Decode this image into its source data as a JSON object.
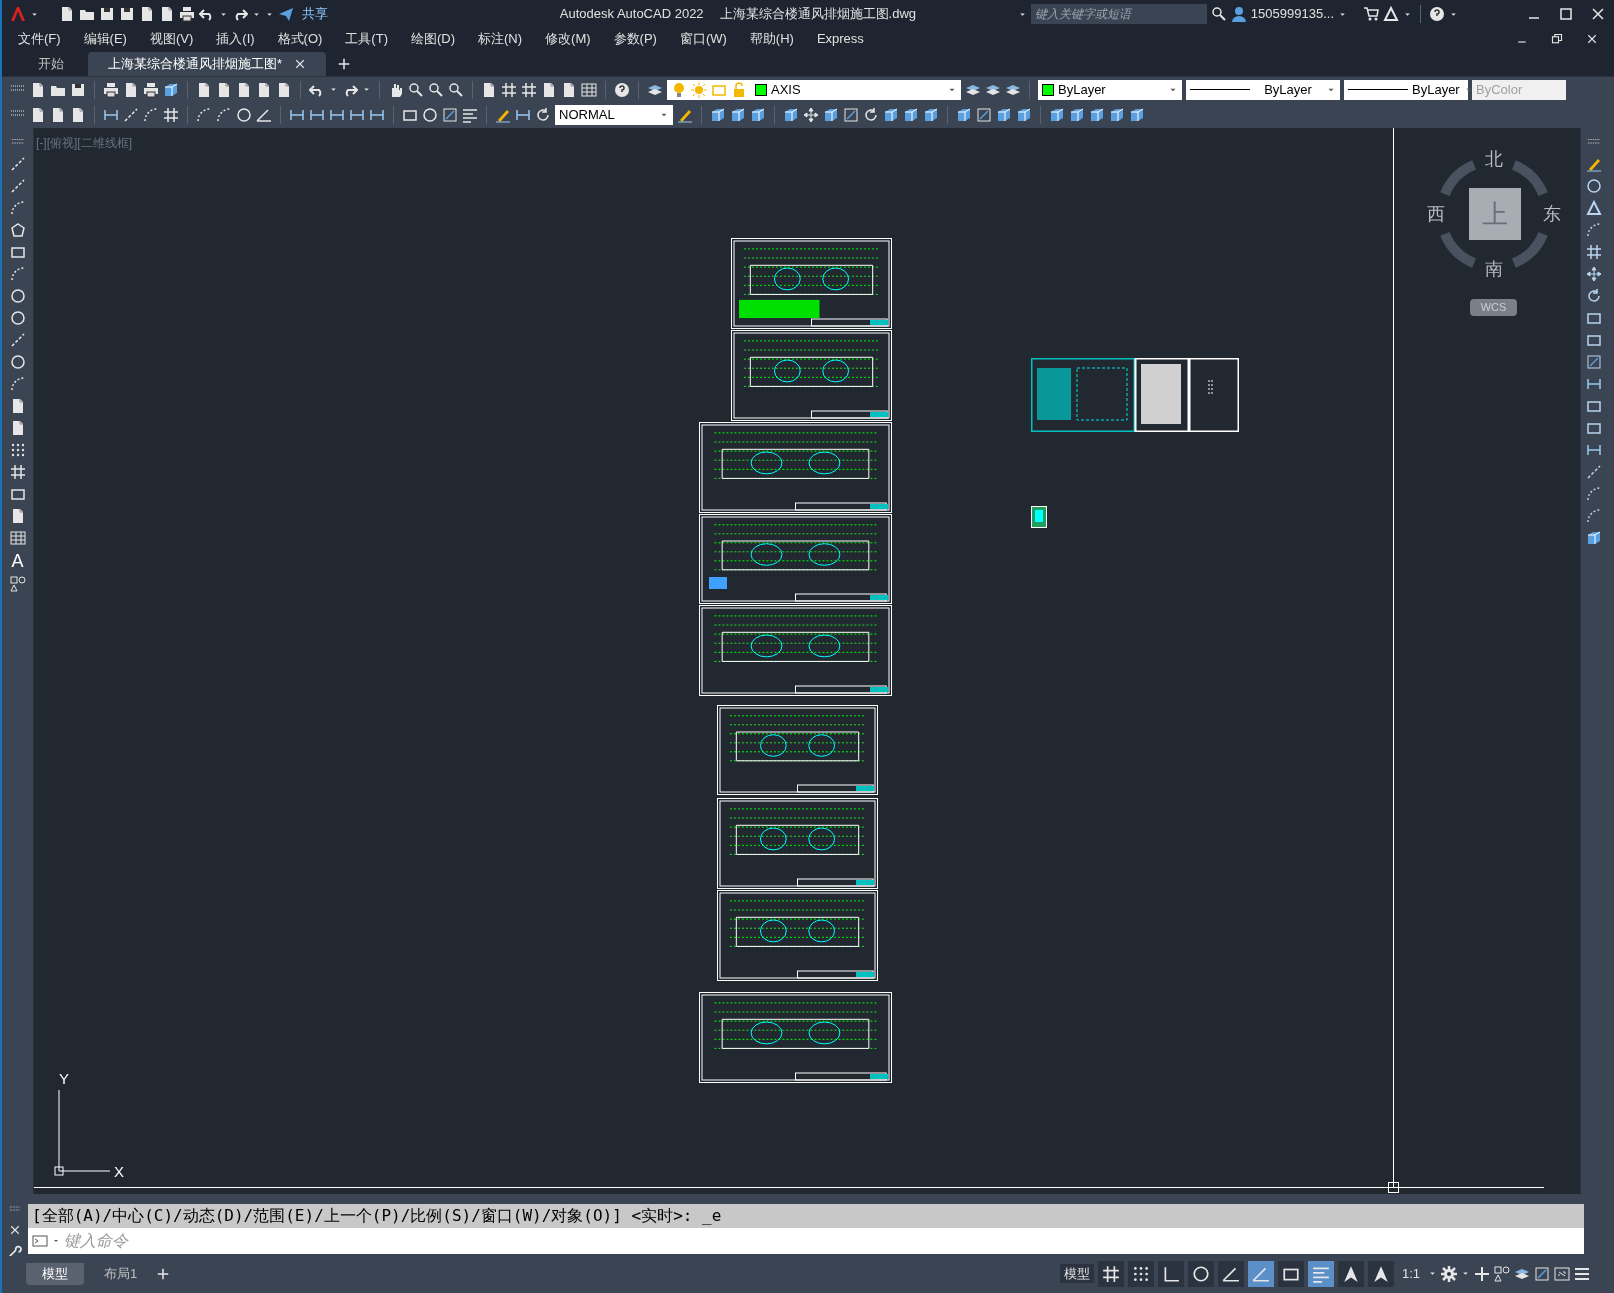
{
  "title_bar": {
    "share_label": "共享",
    "app_title": "Autodesk AutoCAD 2022",
    "file_name": "上海某综合楼通风排烟施工图.dwg",
    "search": {
      "placeholder": "键入关键字或短语"
    },
    "user": "1505999135..."
  },
  "menu": [
    "文件(F)",
    "编辑(E)",
    "视图(V)",
    "插入(I)",
    "格式(O)",
    "工具(T)",
    "绘图(D)",
    "标注(N)",
    "修改(M)",
    "参数(P)",
    "窗口(W)",
    "帮助(H)",
    "Express"
  ],
  "tabs": [
    {
      "label": "开始",
      "selected": false
    },
    {
      "label": "上海某综合楼通风排烟施工图*",
      "selected": true
    }
  ],
  "properties": {
    "layer": {
      "value": "AXIS",
      "color": "#00ff00"
    },
    "color": {
      "value": "ByLayer",
      "color": "#00ff00"
    },
    "linetype": {
      "value": "ByLayer"
    },
    "lineweight": {
      "value": "ByLayer"
    },
    "plot_style": {
      "value": "ByColor",
      "disabled": true
    },
    "text_style": {
      "value": "NORMAL"
    }
  },
  "draw_toolbar": {
    "text_tool": "A"
  },
  "viewport": {
    "label": "[-][俯视][二维线框]"
  },
  "viewcube": {
    "north": "北",
    "south": "南",
    "west": "西",
    "east": "东",
    "face": "上",
    "wcs": "WCS"
  },
  "ucs": {
    "y": "Y",
    "x": "X"
  },
  "command": {
    "history": "[全部(A)/中心(C)/动态(D)/范围(E)/上一个(P)/比例(S)/窗口(W)/对象(O)] <实时>: _e",
    "placeholder": "键入命令"
  },
  "layout_tabs": [
    {
      "label": "模型",
      "selected": true
    },
    {
      "label": "布局1",
      "selected": false
    }
  ],
  "status_bar": {
    "space": "模型",
    "scale": "1:1",
    "toggles": [
      {
        "on": false
      },
      {
        "on": false
      },
      {
        "on": false
      },
      {
        "on": false
      },
      {
        "on": false
      },
      {
        "on": true
      },
      {
        "on": false
      },
      {
        "on": true
      },
      {
        "on": false
      },
      {
        "on": false
      }
    ]
  }
}
